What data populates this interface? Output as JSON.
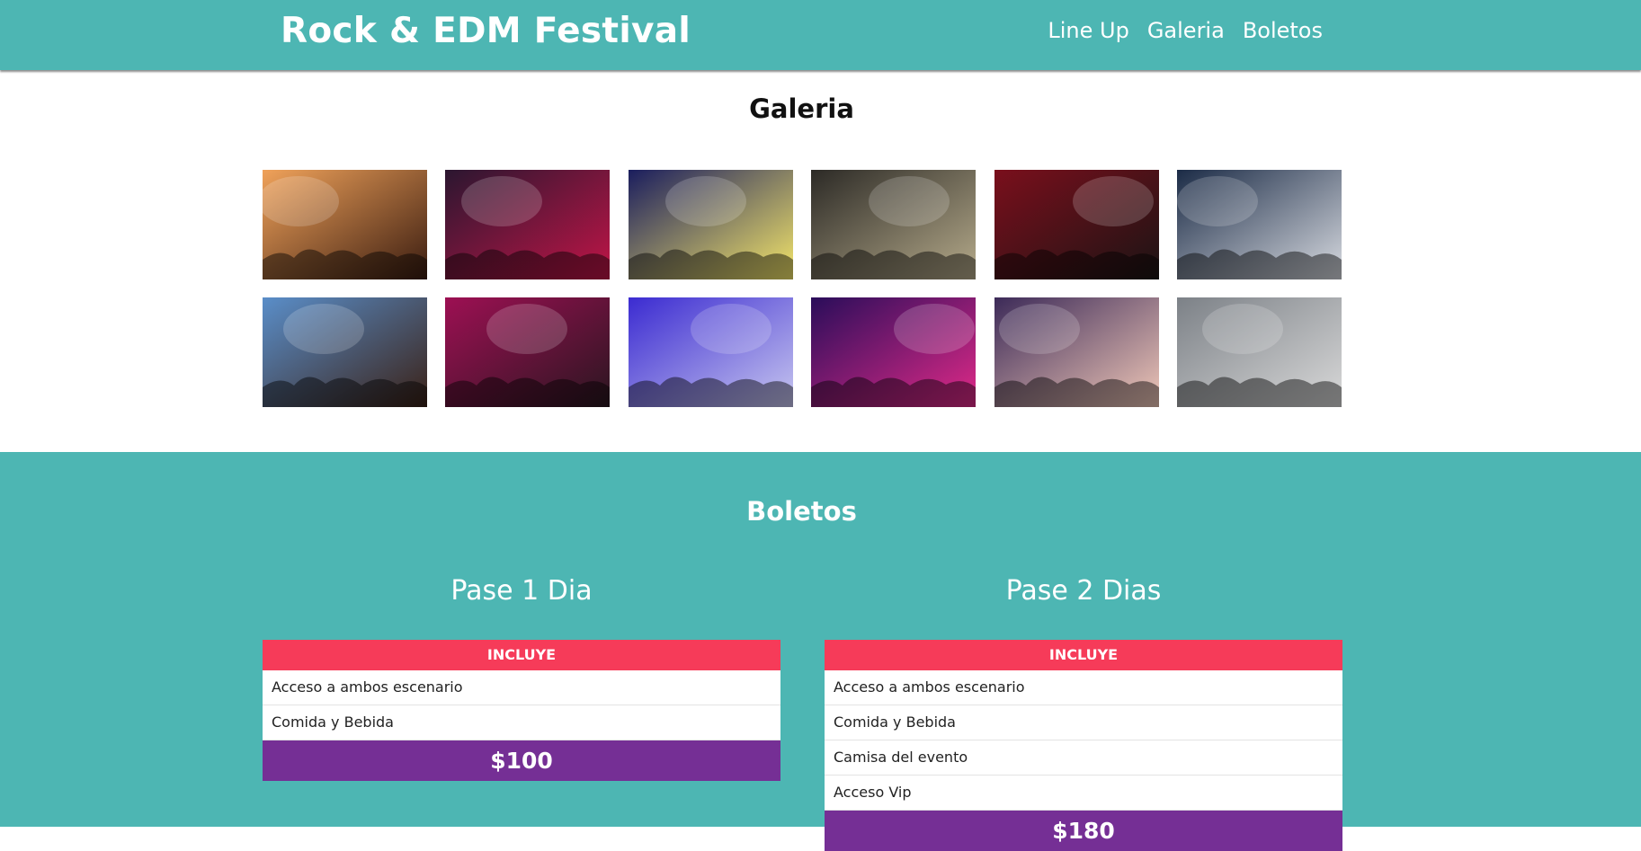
{
  "header": {
    "brand": "Rock & EDM Festival",
    "nav": [
      "Line Up",
      "Galeria",
      "Boletos"
    ]
  },
  "gallery": {
    "title": "Galeria",
    "images": [
      {
        "name": "gallery-image-concert-crowd",
        "colors": [
          "#f0a25a",
          "#3a1c10"
        ]
      },
      {
        "name": "gallery-image-singer",
        "colors": [
          "#2b1630",
          "#c01547"
        ]
      },
      {
        "name": "gallery-image-club-lights",
        "colors": [
          "#1a1d5e",
          "#f5e76a"
        ]
      },
      {
        "name": "gallery-image-dj-turntable",
        "colors": [
          "#2c2a26",
          "#b6ab8b"
        ]
      },
      {
        "name": "gallery-image-guitarist-red",
        "colors": [
          "#7a0f1c",
          "#1b1414"
        ]
      },
      {
        "name": "gallery-image-dj-woman",
        "colors": [
          "#1b2b46",
          "#d8dbe1"
        ]
      },
      {
        "name": "gallery-image-guitar-closeup",
        "colors": [
          "#5a8ec9",
          "#3a2116"
        ]
      },
      {
        "name": "gallery-image-dj-laptop",
        "colors": [
          "#9d1053",
          "#2a1620"
        ]
      },
      {
        "name": "gallery-image-dj-mixer-blue",
        "colors": [
          "#3b2bd1",
          "#c7c6ef"
        ]
      },
      {
        "name": "gallery-image-dj-hand-purple",
        "colors": [
          "#2a0d5a",
          "#e02a88"
        ]
      },
      {
        "name": "gallery-image-band-stage",
        "colors": [
          "#3c2a58",
          "#f0c8b8"
        ]
      },
      {
        "name": "gallery-image-singer-smoke",
        "colors": [
          "#7c8187",
          "#d9d9d9"
        ]
      }
    ]
  },
  "tickets": {
    "title": "Boletos",
    "passes": [
      {
        "name": "Pase 1 Dia",
        "includes_label": "INCLUYE",
        "items": [
          "Acceso a ambos escenario",
          "Comida y Bebida"
        ],
        "price": "$100"
      },
      {
        "name": "Pase 2 Dias",
        "includes_label": "INCLUYE",
        "items": [
          "Acceso a ambos escenario",
          "Comida y Bebida",
          "Camisa del evento",
          "Acceso Vip"
        ],
        "price": "$180"
      }
    ]
  },
  "colors": {
    "teal": "#4db6b3",
    "pink": "#f63b59",
    "purple": "#752f95"
  }
}
